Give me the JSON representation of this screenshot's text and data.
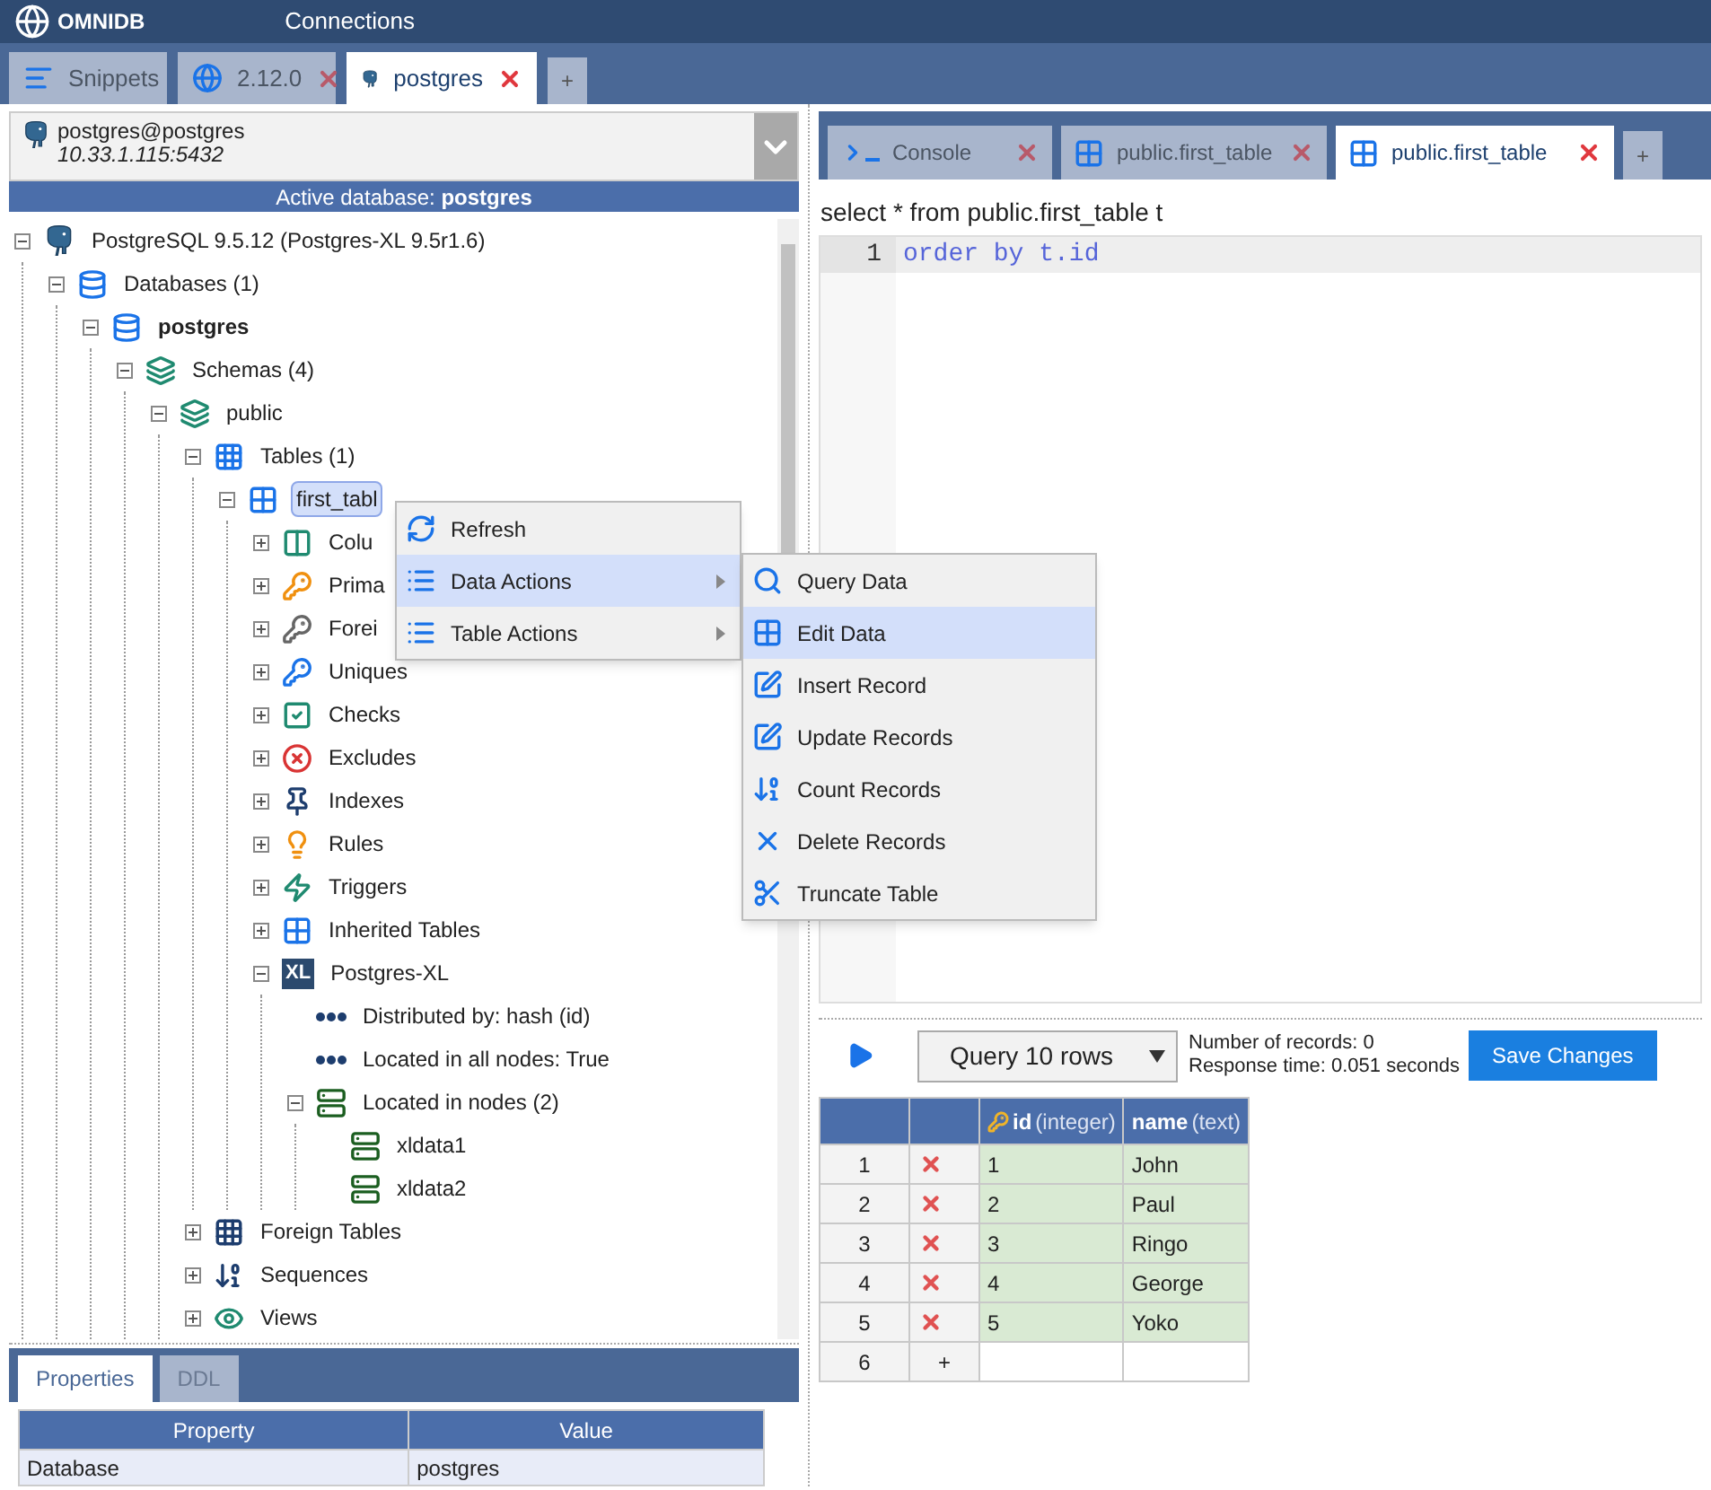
{
  "app": {
    "name": "OMNIDB",
    "menu": "Connections"
  },
  "tabs": [
    {
      "label": "Snippets",
      "kind": "snippets",
      "closable": false,
      "selected": false
    },
    {
      "label": "2.12.0",
      "kind": "globe",
      "closable": true,
      "selected": false
    },
    {
      "label": "postgres",
      "kind": "postgres",
      "closable": true,
      "selected": true
    },
    {
      "label": "+",
      "kind": "add",
      "selected": false
    }
  ],
  "connection": {
    "name": "postgres@postgres",
    "address": "10.33.1.115:5432",
    "active_label": "Active database: ",
    "active_db": "postgres"
  },
  "tree": [
    {
      "label": "PostgreSQL 9.5.12 (Postgres-XL 9.5r1.6)",
      "kind": "server",
      "expanded": true,
      "selected": false,
      "children": [
        {
          "label": "Databases (1)",
          "kind": "databases",
          "expanded": true,
          "selected": false,
          "children": [
            {
              "label": "postgres",
              "kind": "database",
              "expanded": true,
              "selected": false,
              "children": [
                {
                  "label": "Schemas (4)",
                  "kind": "schemas",
                  "expanded": true,
                  "selected": false,
                  "children": [
                    {
                      "label": "public",
                      "kind": "schema",
                      "expanded": true,
                      "selected": false,
                      "children": [
                        {
                          "label": "Tables (1)",
                          "kind": "tables",
                          "expanded": true,
                          "selected": false,
                          "children": [
                            {
                              "label": "first_tabl",
                              "kind": "table",
                              "expanded": true,
                              "selected": true,
                              "children": [
                                {
                                  "label": "Colu",
                                  "kind": "columns",
                                  "expanded": false,
                                  "selected": false
                                },
                                {
                                  "label": "Prima",
                                  "kind": "pk",
                                  "expanded": false,
                                  "selected": false
                                },
                                {
                                  "label": "Forei",
                                  "kind": "fk",
                                  "expanded": false,
                                  "selected": false
                                },
                                {
                                  "label": "Uniques",
                                  "kind": "uniques",
                                  "expanded": false,
                                  "selected": false
                                },
                                {
                                  "label": "Checks",
                                  "kind": "checks",
                                  "expanded": false,
                                  "selected": false
                                },
                                {
                                  "label": "Excludes",
                                  "kind": "excludes",
                                  "expanded": false,
                                  "selected": false
                                },
                                {
                                  "label": "Indexes",
                                  "kind": "indexes",
                                  "expanded": false,
                                  "selected": false
                                },
                                {
                                  "label": "Rules",
                                  "kind": "rules",
                                  "expanded": false,
                                  "selected": false
                                },
                                {
                                  "label": "Triggers",
                                  "kind": "triggers",
                                  "expanded": false,
                                  "selected": false
                                },
                                {
                                  "label": "Inherited Tables",
                                  "kind": "inherited",
                                  "expanded": false,
                                  "selected": false
                                },
                                {
                                  "label": "Postgres-XL",
                                  "kind": "xl",
                                  "badge": "XL",
                                  "expanded": true,
                                  "selected": false,
                                  "children": [
                                    {
                                      "label": "Distributed by: hash (id)",
                                      "kind": "property",
                                      "selected": false
                                    },
                                    {
                                      "label": "Located in all nodes: True",
                                      "kind": "property",
                                      "selected": false
                                    },
                                    {
                                      "label": "Located in nodes (2)",
                                      "kind": "nodes",
                                      "expanded": true,
                                      "selected": false,
                                      "children": [
                                        {
                                          "label": "xldata1",
                                          "kind": "node",
                                          "selected": false
                                        },
                                        {
                                          "label": "xldata2",
                                          "kind": "node",
                                          "selected": false
                                        }
                                      ]
                                    }
                                  ]
                                }
                              ]
                            }
                          ]
                        },
                        {
                          "label": "Foreign Tables",
                          "kind": "foreign",
                          "expanded": false,
                          "selected": false
                        },
                        {
                          "label": "Sequences",
                          "kind": "sequences",
                          "expanded": false,
                          "selected": false
                        },
                        {
                          "label": "Views",
                          "kind": "views",
                          "expanded": false,
                          "selected": false
                        }
                      ]
                    }
                  ]
                }
              ]
            }
          ]
        }
      ]
    }
  ],
  "context_menu": [
    {
      "label": "Refresh",
      "kind": "refresh",
      "submenu": false,
      "selected": false
    },
    {
      "label": "Data Actions",
      "kind": "list",
      "submenu": true,
      "selected": true
    },
    {
      "label": "Table Actions",
      "kind": "list",
      "submenu": true,
      "selected": false
    }
  ],
  "submenu": [
    {
      "label": "Query Data",
      "kind": "search",
      "selected": false
    },
    {
      "label": "Edit Data",
      "kind": "grid",
      "selected": true
    },
    {
      "label": "Insert Record",
      "kind": "edit",
      "selected": false
    },
    {
      "label": "Update Records",
      "kind": "edit",
      "selected": false
    },
    {
      "label": "Count Records",
      "kind": "count",
      "selected": false
    },
    {
      "label": "Delete Records",
      "kind": "delete",
      "selected": false
    },
    {
      "label": "Truncate Table",
      "kind": "scissors",
      "selected": false
    }
  ],
  "properties": {
    "tabs": [
      {
        "label": "Properties",
        "selected": true
      },
      {
        "label": "DDL",
        "selected": false
      }
    ],
    "columns": [
      "Property",
      "Value"
    ],
    "rows": [
      [
        "Database",
        "postgres"
      ]
    ]
  },
  "editor_tabs": [
    {
      "label": "Console",
      "kind": "console",
      "closable": true,
      "selected": false
    },
    {
      "label": "public.first_table",
      "kind": "table",
      "closable": true,
      "selected": false
    },
    {
      "label": "public.first_table",
      "kind": "table",
      "closable": true,
      "selected": true
    },
    {
      "label": "+",
      "kind": "add",
      "selected": false
    }
  ],
  "query_text": "select * from public.first_table t",
  "editor": {
    "lines": [
      {
        "number": "1",
        "code": "order by t.id"
      }
    ]
  },
  "toolbar": {
    "limit": "Query 10 rows",
    "records": "Number of records: 0",
    "response": "Response time: 0.051 seconds",
    "save": "Save Changes"
  },
  "grid": {
    "columns": [
      {
        "label": "id",
        "type": "(integer)",
        "primary_key": true
      },
      {
        "label": "name",
        "type": "(text)",
        "primary_key": false
      }
    ],
    "rows": [
      {
        "number": "1",
        "kind": "record",
        "cells": [
          "1",
          "John"
        ]
      },
      {
        "number": "2",
        "kind": "record",
        "cells": [
          "2",
          "Paul"
        ]
      },
      {
        "number": "3",
        "kind": "record",
        "cells": [
          "3",
          "Ringo"
        ]
      },
      {
        "number": "4",
        "kind": "record",
        "cells": [
          "4",
          "George"
        ]
      },
      {
        "number": "5",
        "kind": "record",
        "cells": [
          "5",
          "Yoko"
        ]
      },
      {
        "number": "6",
        "kind": "new",
        "action": "+",
        "cells": []
      }
    ]
  }
}
